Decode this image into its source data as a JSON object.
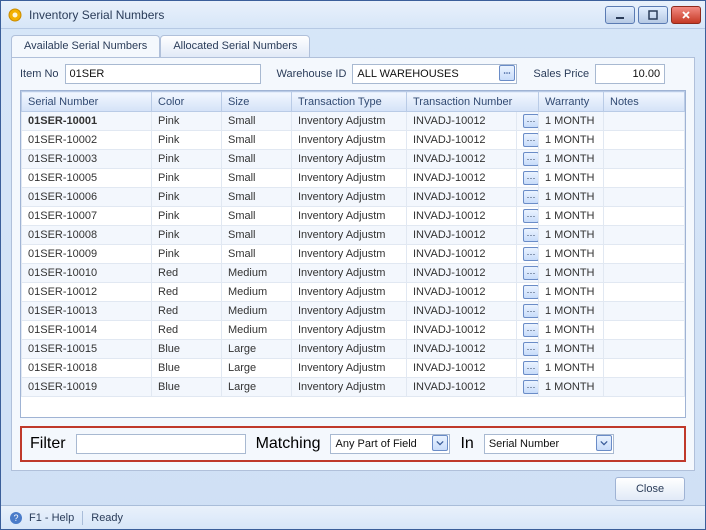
{
  "window": {
    "title": "Inventory Serial Numbers"
  },
  "tabs": [
    {
      "label": "Available Serial Numbers",
      "active": true
    },
    {
      "label": "Allocated Serial Numbers",
      "active": false
    }
  ],
  "fields": {
    "item_no_label": "Item No",
    "item_no_value": "01SER",
    "warehouse_label": "Warehouse ID",
    "warehouse_value": "ALL WAREHOUSES",
    "sales_price_label": "Sales Price",
    "sales_price_value": "10.00"
  },
  "grid": {
    "columns": [
      "Serial Number",
      "Color",
      "Size",
      "Transaction Type",
      "Transaction Number",
      "Warranty",
      "Notes"
    ],
    "rows": [
      [
        "01SER-10001",
        "Pink",
        "Small",
        "Inventory Adjustm",
        "INVADJ-10012",
        "1 MONTH",
        ""
      ],
      [
        "01SER-10002",
        "Pink",
        "Small",
        "Inventory Adjustm",
        "INVADJ-10012",
        "1 MONTH",
        ""
      ],
      [
        "01SER-10003",
        "Pink",
        "Small",
        "Inventory Adjustm",
        "INVADJ-10012",
        "1 MONTH",
        ""
      ],
      [
        "01SER-10005",
        "Pink",
        "Small",
        "Inventory Adjustm",
        "INVADJ-10012",
        "1 MONTH",
        ""
      ],
      [
        "01SER-10006",
        "Pink",
        "Small",
        "Inventory Adjustm",
        "INVADJ-10012",
        "1 MONTH",
        ""
      ],
      [
        "01SER-10007",
        "Pink",
        "Small",
        "Inventory Adjustm",
        "INVADJ-10012",
        "1 MONTH",
        ""
      ],
      [
        "01SER-10008",
        "Pink",
        "Small",
        "Inventory Adjustm",
        "INVADJ-10012",
        "1 MONTH",
        ""
      ],
      [
        "01SER-10009",
        "Pink",
        "Small",
        "Inventory Adjustm",
        "INVADJ-10012",
        "1 MONTH",
        ""
      ],
      [
        "01SER-10010",
        "Red",
        "Medium",
        "Inventory Adjustm",
        "INVADJ-10012",
        "1 MONTH",
        ""
      ],
      [
        "01SER-10012",
        "Red",
        "Medium",
        "Inventory Adjustm",
        "INVADJ-10012",
        "1 MONTH",
        ""
      ],
      [
        "01SER-10013",
        "Red",
        "Medium",
        "Inventory Adjustm",
        "INVADJ-10012",
        "1 MONTH",
        ""
      ],
      [
        "01SER-10014",
        "Red",
        "Medium",
        "Inventory Adjustm",
        "INVADJ-10012",
        "1 MONTH",
        ""
      ],
      [
        "01SER-10015",
        "Blue",
        "Large",
        "Inventory Adjustm",
        "INVADJ-10012",
        "1 MONTH",
        ""
      ],
      [
        "01SER-10018",
        "Blue",
        "Large",
        "Inventory Adjustm",
        "INVADJ-10012",
        "1 MONTH",
        ""
      ],
      [
        "01SER-10019",
        "Blue",
        "Large",
        "Inventory Adjustm",
        "INVADJ-10012",
        "1 MONTH",
        ""
      ]
    ]
  },
  "filter": {
    "label": "Filter",
    "value": "",
    "matching_label": "Matching",
    "matching_value": "Any Part of Field",
    "in_label": "In",
    "in_value": "Serial Number"
  },
  "buttons": {
    "close": "Close"
  },
  "status": {
    "help": "F1 - Help",
    "ready": "Ready"
  }
}
